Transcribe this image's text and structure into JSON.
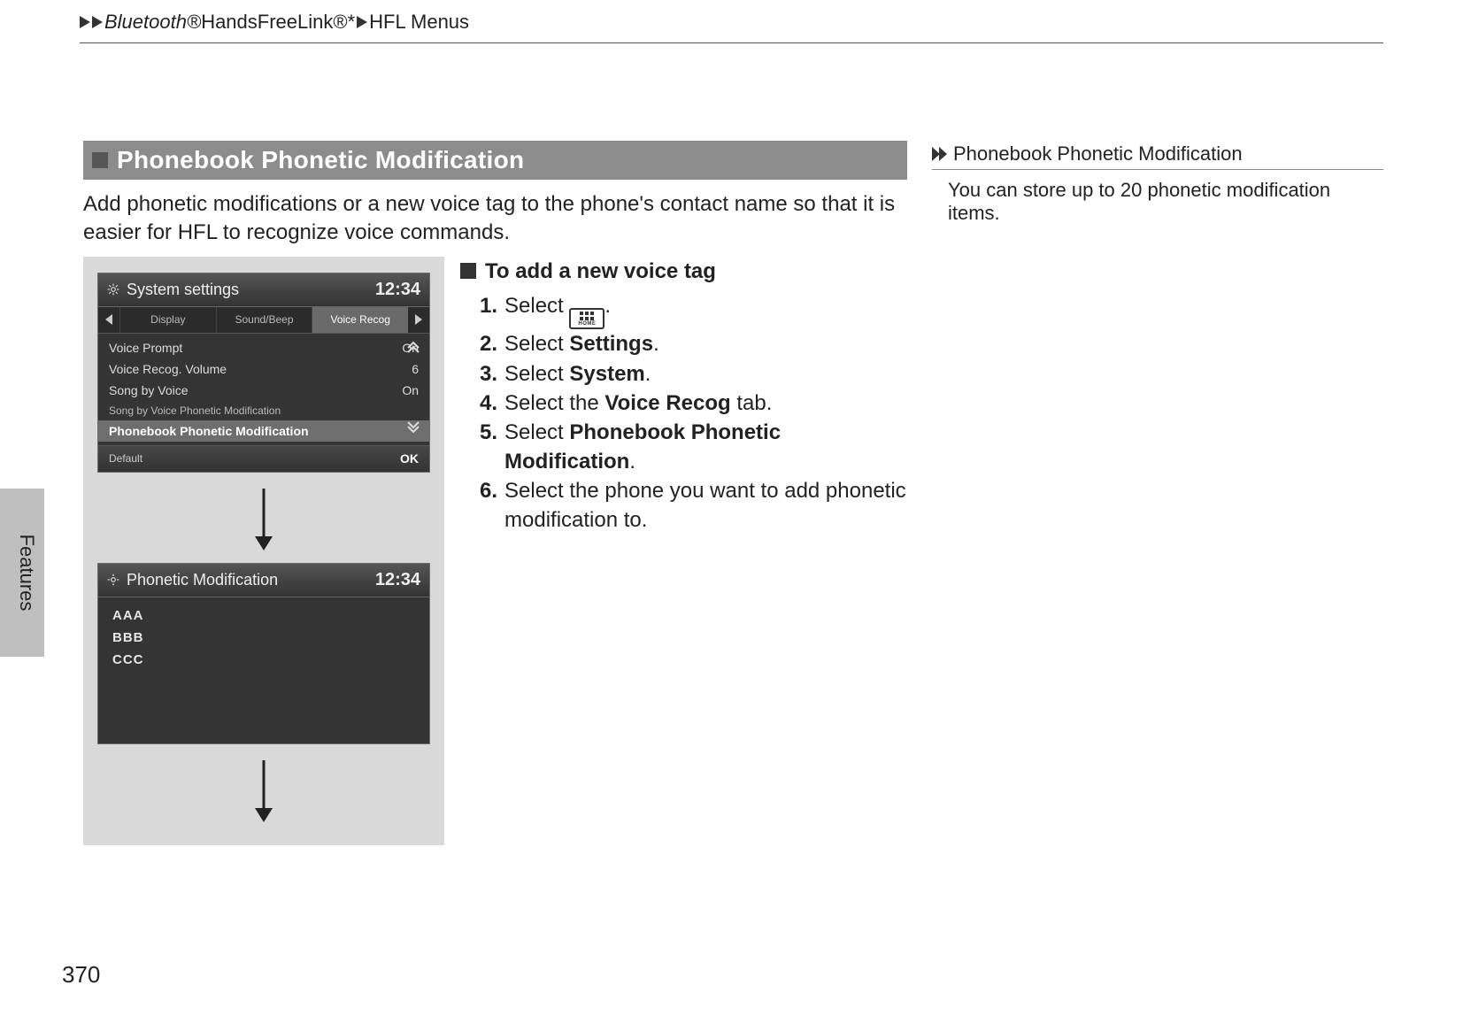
{
  "header": {
    "seg1_italic": "Bluetooth",
    "seg1_sup": "®",
    "seg2": " HandsFreeLink",
    "seg2_sup": "®",
    "seg2_ast": "*",
    "seg3": "HFL Menus"
  },
  "side_tab": "Features",
  "heading": "Phonebook Phonetic Modification",
  "intro": "Add phonetic modifications or a new voice tag to the phone's contact name so that it is easier for HFL to recognize voice commands.",
  "screens": {
    "sys": {
      "title": "System settings",
      "clock": "12:34",
      "tabs": {
        "t1": "Display",
        "t2": "Sound/Beep",
        "t3": "Voice Recog"
      },
      "rows": {
        "r1l": "Voice Prompt",
        "r1v": "On",
        "r2l": "Voice Recog. Volume",
        "r2v": "6",
        "r3l": "Song by Voice",
        "r3v": "On",
        "r4l": "Song by Voice Phonetic Modification",
        "r5l": "Phonebook Phonetic Modification"
      },
      "foot_l": "Default",
      "foot_r": "OK"
    },
    "pm": {
      "title": "Phonetic Modification",
      "clock": "12:34",
      "a": "AAA",
      "b": "BBB",
      "c": "CCC"
    }
  },
  "steps": {
    "subhead": "To add a new voice tag",
    "home_label": "HOME",
    "s1_pre": "Select ",
    "s2_pre": "Select ",
    "s2_b": "Settings",
    "s3_pre": "Select ",
    "s3_b": "System",
    "s4_pre": "Select the ",
    "s4_b": "Voice Recog",
    "s4_post": " tab.",
    "s5_pre": "Select ",
    "s5_b": "Phonebook Phonetic Modification",
    "s6": "Select the phone you want to add phonetic modification to."
  },
  "note": {
    "title": "Phonebook Phonetic Modification",
    "body": "You can store up to 20 phonetic modification items."
  },
  "page_number": "370"
}
